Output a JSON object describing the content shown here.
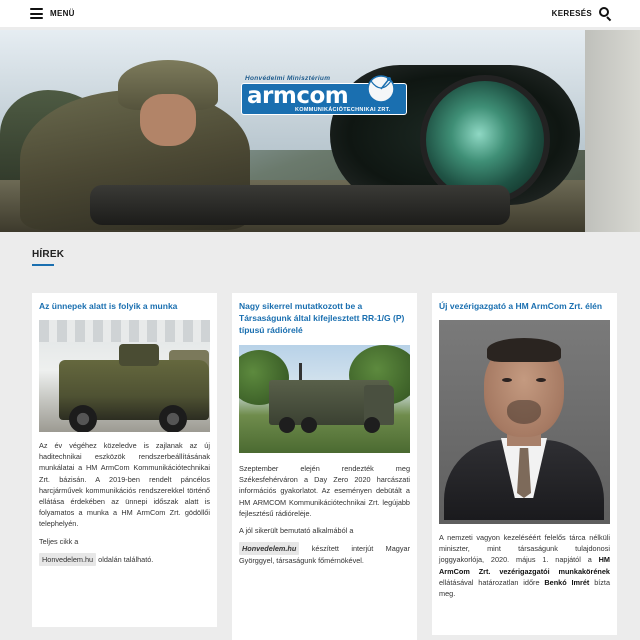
{
  "header": {
    "menu_label": "MENÜ",
    "search_label": "KERESÉS",
    "menu_icon": "hamburger-menu-icon",
    "search_icon": "search-icon"
  },
  "hero": {
    "logo": {
      "top_text": "Honvédelmi Minisztérium",
      "word": "armcom",
      "sub_text": "KOMMUNIKÁCIÓTECHNIKAI ZRT."
    }
  },
  "section": {
    "title": "HÍREK"
  },
  "cards": [
    {
      "title": "Az ünnepek alatt is folyik a munka",
      "paragraphs": [
        "Az év végéhez közeledve is zajlanak az új haditechnikai eszközök rendszerbeállításának munkálatai a HM ArmCom Kommunikációtechnikai Zrt. bázisán. A 2019-ben rendelt páncélos harcjárművek kommunikációs rendszerekkel történő ellátása érdekében az ünnepi időszak alatt is folyamatos a munka a HM ArmCom Zrt. gödöllői telephelyén.",
        "Teljes cikk a"
      ],
      "link_text": "Honvedelem.hu",
      "after_link": "oldalán található."
    },
    {
      "title": "Nagy sikerrel mutatkozott be a Társaságunk által kifejlesztett RR-1/G (P) típusú rádiórelé",
      "paragraphs": [
        "Szeptember elején rendezték meg Székesfehérváron a Day Zero 2020 harcászati információs gyakorlatot. Az eseményen debütált a HM ARMCOM Kommunikációtechnikai Zrt. legújabb fejlesztésű rádiórelėje.",
        "A jól sikerült bemutató alkalmából a"
      ],
      "link_text": "Honvedelem.hu",
      "after_link": "készített interjút Magyar Györggyel, társaságunk főmérnökével."
    },
    {
      "title": "Új vezérigazgató a HM ArmCom Zrt. élén",
      "text_pre": "A nemzeti vagyon kezeléséért felelős tárca nélküli miniszter, mint társaságunk tulajdonosi joggyakorlója, 2020. május 1. napjától a",
      "bold_1": "HM ArmCom Zrt. vezérigazgatói munkakörének",
      "text_mid": "ellátásával határozatlan időre",
      "bold_2": "Benkó Imrét",
      "text_post": "bízta meg."
    }
  ]
}
